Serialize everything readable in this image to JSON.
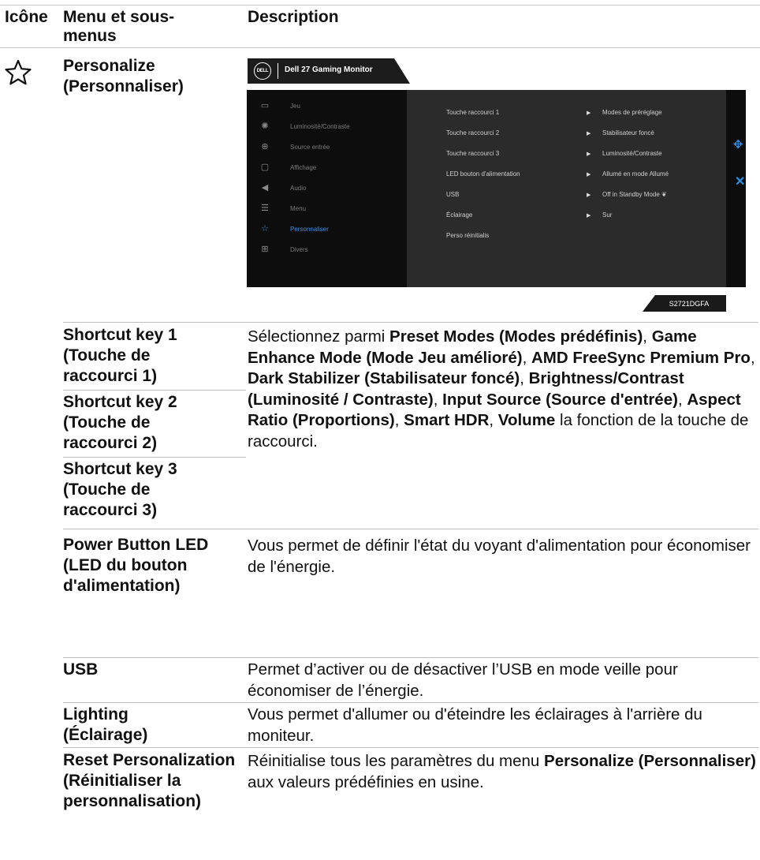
{
  "header": {
    "col_icon": "Icône",
    "col_menu": "Menu et sous-menus",
    "col_desc": "Description"
  },
  "section": {
    "name": "Personalize (Personnaliser)",
    "icon": "star-icon"
  },
  "osd": {
    "title": "Dell 27 Gaming Monitor",
    "logo": "DELL",
    "model": "S2721DGFA",
    "menu_items": [
      {
        "icon": "gamepad-icon",
        "label": "Jeu"
      },
      {
        "icon": "brightness-icon",
        "label": "Luminosité/Contraste"
      },
      {
        "icon": "input-source-icon",
        "label": "Source entrée"
      },
      {
        "icon": "display-icon",
        "label": "Affichage"
      },
      {
        "icon": "audio-icon",
        "label": "Audio"
      },
      {
        "icon": "menu-icon",
        "label": "Menu"
      },
      {
        "icon": "star-icon",
        "label": "Personnaliser"
      },
      {
        "icon": "others-icon",
        "label": "Divers"
      }
    ],
    "selected_item": "Personnaliser",
    "sub_items": [
      {
        "label": "Touche raccourci 1",
        "value": "Modes de préréglage"
      },
      {
        "label": "Touche raccourci 2",
        "value": "Stabilisateur foncé"
      },
      {
        "label": "Touche raccourci 3",
        "value": "Luminosité/Contraste"
      },
      {
        "label": "LED bouton d'alimentation",
        "value": "Allumé en mode Allumé"
      },
      {
        "label": "USB",
        "value": "Off in Standby Mode"
      },
      {
        "label": "Éclairage",
        "value": "Sur"
      },
      {
        "label": "Perso réinitialis",
        "value": ""
      }
    ]
  },
  "rows": [
    {
      "name": "Shortcut key 1 (Touche de raccourci 1)"
    },
    {
      "name": "Shortcut key 2 (Touche de raccourci 2)"
    },
    {
      "name": "Shortcut key 3 (Touche de raccourci 3)"
    },
    {
      "name": "Power Button LED (LED du bouton d'alimentation)",
      "desc": "Vous permet de définir l'état du voyant d'alimentation pour économiser de l'énergie."
    },
    {
      "name": "USB",
      "desc": "Permet d’activer ou de désactiver l’USB en mode veille pour économiser de l’énergie."
    },
    {
      "name": "Lighting (Éclairage)",
      "desc": "Vous permet d'allumer ou d'éteindre les éclairages à l'arrière du moniteur."
    },
    {
      "name": "Reset Personalization (Réinitialiser la personnalisation)"
    }
  ],
  "shortcut_desc": {
    "intro": "Sélectionnez parmi",
    "opt1": "Preset Modes (Modes prédéfinis)",
    "opt2": "Game Enhance Mode (Mode Jeu amélioré)",
    "opt3": "AMD FreeSync Premium Pro",
    "opt4": "Dark Stabilizer (Stabilisateur foncé)",
    "opt5": "Brightness/Contrast (Luminosité / Contraste)",
    "opt6": "Input Source (Source d'entrée)",
    "opt7": "Aspect Ratio (Proportions)",
    "opt8": "Smart HDR",
    "opt9": "Volume",
    "outro": "la fonction de la touche de raccourci."
  },
  "reset_desc": {
    "pre": "Réinitialise tous les paramètres du menu",
    "bold": "Personalize (Personnaliser)",
    "post": "aux valeurs prédéfinies en usine."
  }
}
